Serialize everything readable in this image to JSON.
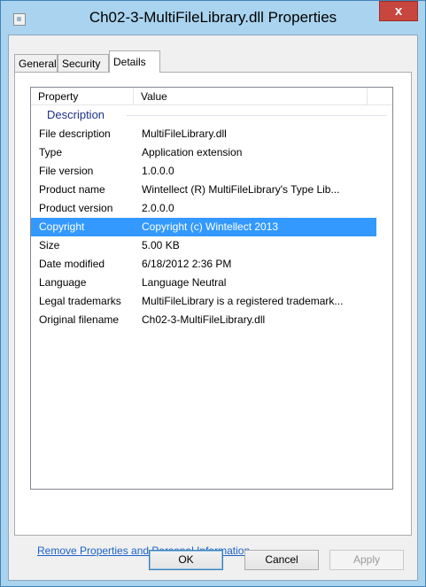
{
  "window": {
    "title": "Ch02-3-MultiFileLibrary.dll Properties",
    "close_label": "x"
  },
  "tabs": [
    {
      "label": "General"
    },
    {
      "label": "Security"
    },
    {
      "label": "Details"
    }
  ],
  "list": {
    "columns": [
      "Property",
      "Value"
    ],
    "group": "Description",
    "rows": [
      {
        "property": "File description",
        "value": "MultiFileLibrary.dll"
      },
      {
        "property": "Type",
        "value": "Application extension"
      },
      {
        "property": "File version",
        "value": "1.0.0.0"
      },
      {
        "property": "Product name",
        "value": "Wintellect (R) MultiFileLibrary's Type Lib..."
      },
      {
        "property": "Product version",
        "value": "2.0.0.0"
      },
      {
        "property": "Copyright",
        "value": "Copyright (c) Wintellect 2013"
      },
      {
        "property": "Size",
        "value": "5.00 KB"
      },
      {
        "property": "Date modified",
        "value": "6/18/2012 2:36 PM"
      },
      {
        "property": "Language",
        "value": "Language Neutral"
      },
      {
        "property": "Legal trademarks",
        "value": "MultiFileLibrary is a registered trademark..."
      },
      {
        "property": "Original filename",
        "value": "Ch02-3-MultiFileLibrary.dll"
      }
    ]
  },
  "link": "Remove Properties and Personal Information",
  "buttons": {
    "ok": "OK",
    "cancel": "Cancel",
    "apply": "Apply"
  }
}
